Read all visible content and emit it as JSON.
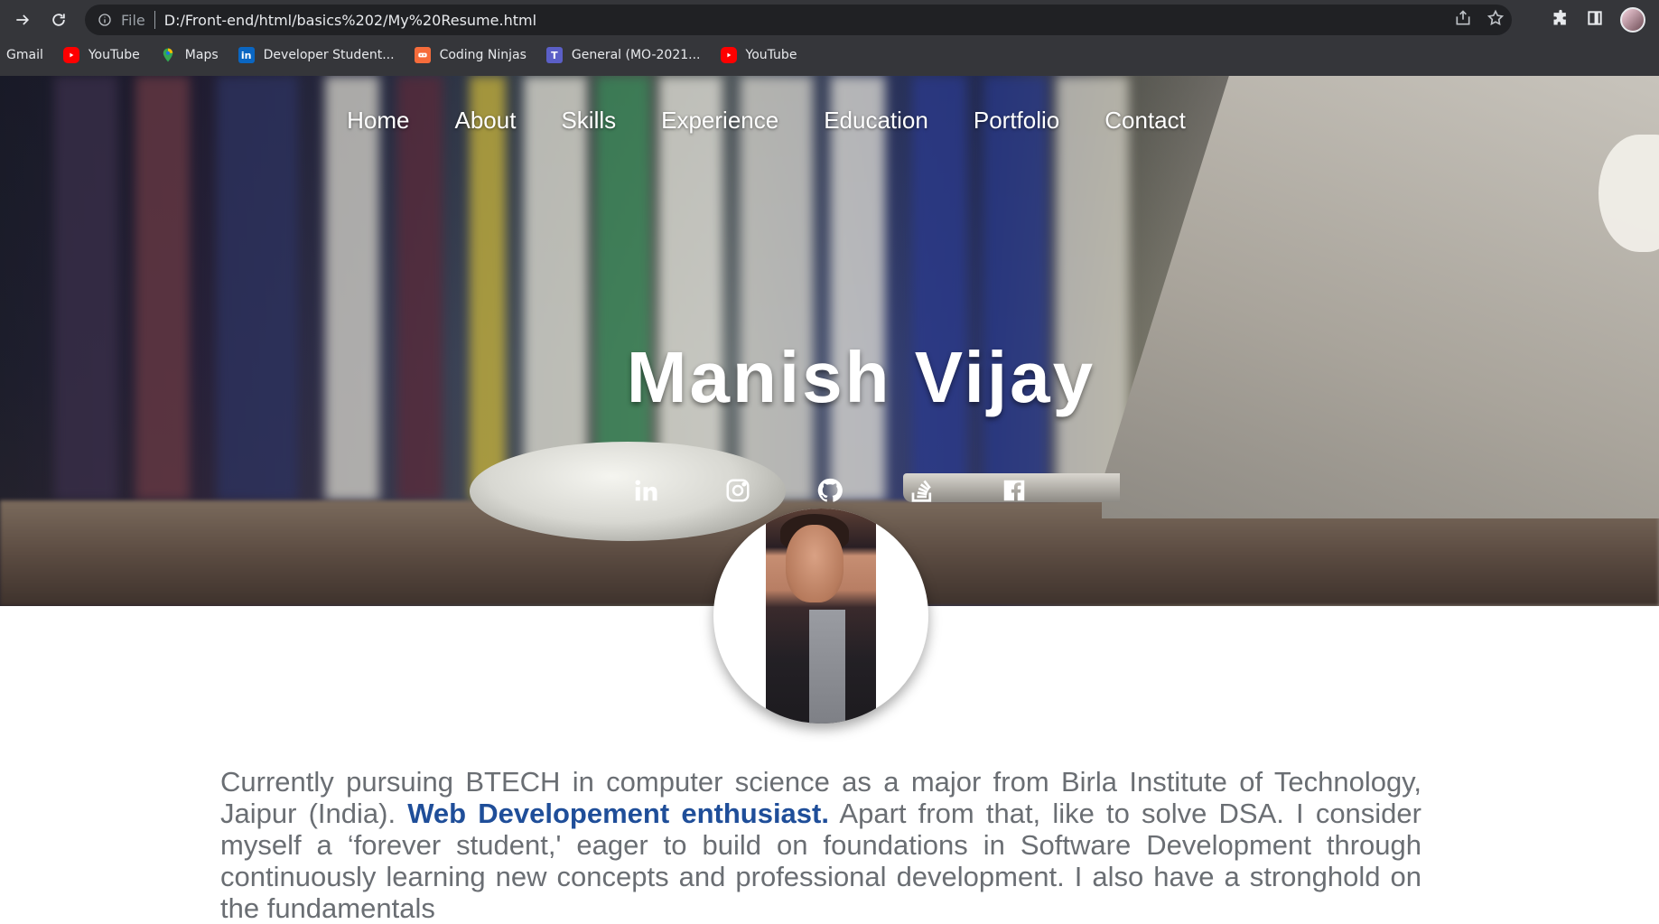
{
  "browser": {
    "omnibox_scheme": "File",
    "url": "D:/Front-end/html/basics%202/My%20Resume.html",
    "bookmarks": [
      {
        "label": "Gmail",
        "icon": "gmail"
      },
      {
        "label": "YouTube",
        "icon": "youtube-icon"
      },
      {
        "label": "Maps",
        "icon": "maps-icon"
      },
      {
        "label": "Developer Student...",
        "icon": "linkedin-icon"
      },
      {
        "label": "Coding Ninjas",
        "icon": "coding-ninjas-icon"
      },
      {
        "label": "General (MO-2021...",
        "icon": "teams-icon"
      },
      {
        "label": "YouTube",
        "icon": "youtube-icon"
      }
    ],
    "bookmark_icon_letters": {
      "linkedin": "in",
      "teams": "T"
    }
  },
  "nav": {
    "items": [
      "Home",
      "About",
      "Skills",
      "Experience",
      "Education",
      "Portfolio",
      "Contact"
    ]
  },
  "hero": {
    "name": "Manish Vijay",
    "socials": [
      "linkedin-icon",
      "instagram-icon",
      "github-icon",
      "stack-overflow-icon",
      "facebook-icon"
    ]
  },
  "about": {
    "text_before": "Currently pursuing BTECH in computer science as a major from Birla Institute of Technology, Jaipur (India). ",
    "highlight": "Web Developement enthusiast.",
    "text_after": " Apart from that, like to solve DSA. I consider myself a ‘forever student,' eager to build on foundations in Software Development through continuously learning new concepts and professional development. I also have a stronghold on the fundamentals"
  },
  "colors": {
    "chrome_bg": "#35363a",
    "omnibox_bg": "#202124",
    "highlight": "#1f4e99",
    "body_text": "#6a6e73"
  }
}
